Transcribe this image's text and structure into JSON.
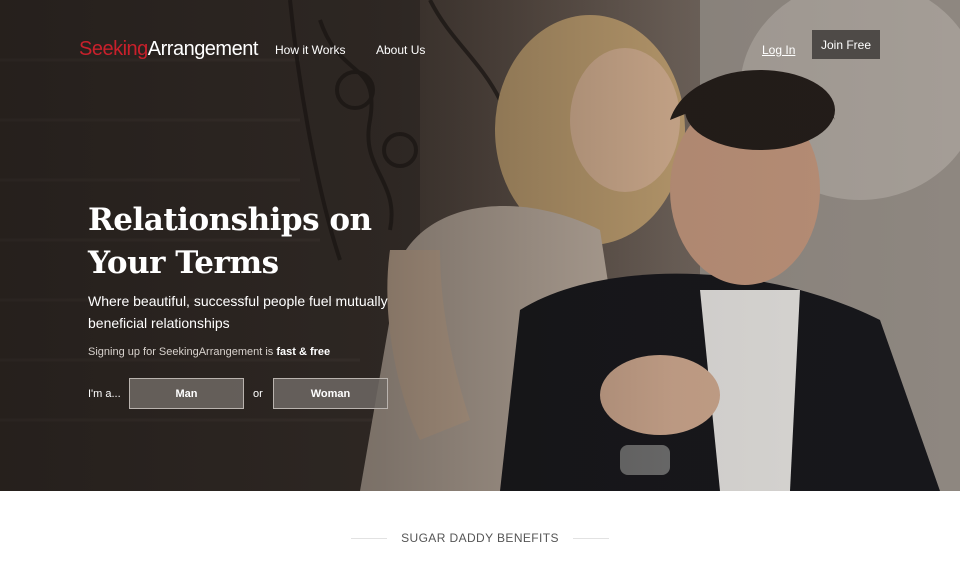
{
  "nav": {
    "logo_part1": "Seeking",
    "logo_part2": "Arrangement",
    "how_it_works": "How it Works",
    "about_us": "About Us",
    "log_in": "Log In",
    "join_free": "Join Free"
  },
  "hero": {
    "headline": "Relationships on Your Terms",
    "subheadline": "Where beautiful, successful people fuel mutually beneficial relationships",
    "signup_note_prefix": "Signing up for SeekingArrangement is ",
    "signup_note_bold": "fast & free",
    "i_am_label": "I'm a...",
    "man_button": "Man",
    "or_label": "or",
    "woman_button": "Woman"
  },
  "section": {
    "benefits_title": "SUGAR DADDY BENEFITS"
  },
  "colors": {
    "brand_red": "#c8202b",
    "join_button_bg": "#4e4a47"
  }
}
